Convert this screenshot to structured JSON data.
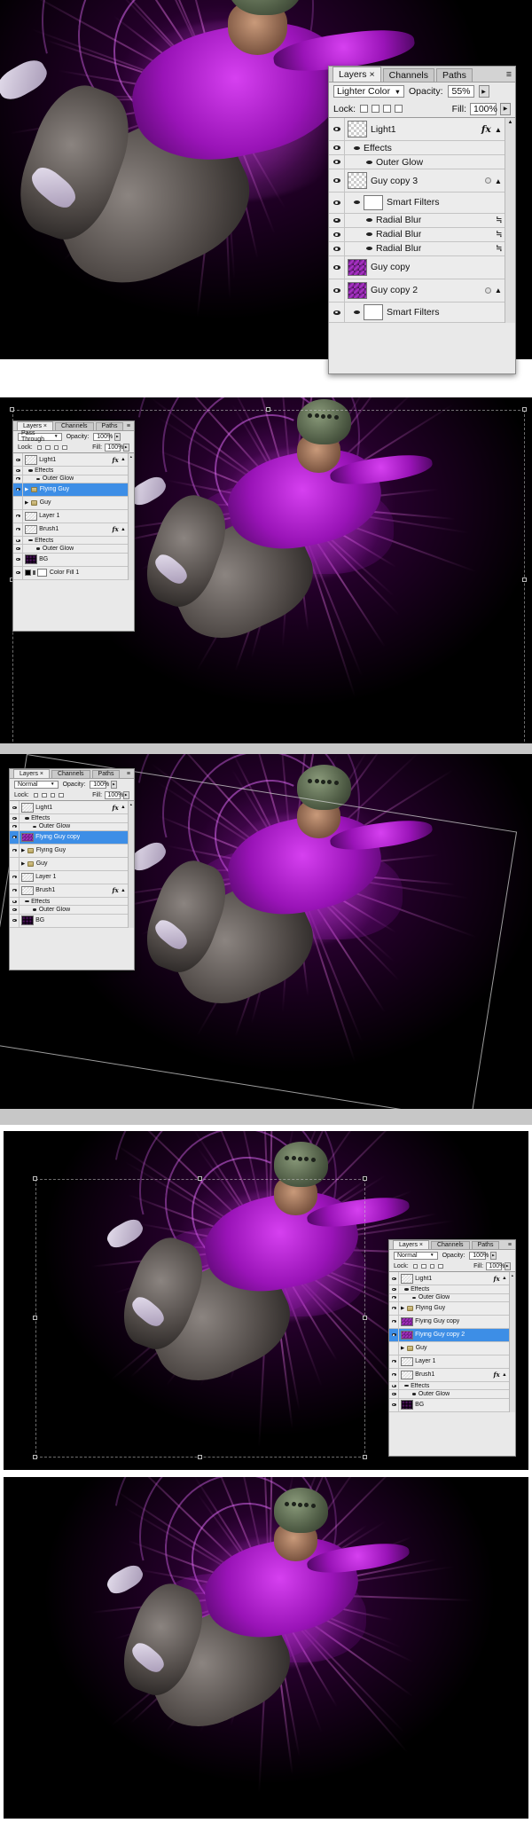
{
  "colors": {
    "panel_bg": "#e9e9e9",
    "selected_row": "#3d8ee6",
    "glow_magenta": "#d640f0",
    "separator_gray": "#c7c7c7"
  },
  "panel1": {
    "tabs": [
      "Layers",
      "Channels",
      "Paths"
    ],
    "tab_close": "×",
    "blend_mode": "Lighter Color",
    "opacity_label": "Opacity:",
    "opacity_value": "55%",
    "lock_label": "Lock:",
    "fill_label": "Fill:",
    "fill_value": "100%",
    "layers": [
      {
        "name": "Light1",
        "kind": "layer",
        "thumb": "checker",
        "badge": "fx"
      },
      {
        "name": "Effects",
        "kind": "effects"
      },
      {
        "name": "Outer Glow",
        "kind": "effect-item"
      },
      {
        "name": "Guy copy 3",
        "kind": "layer",
        "thumb": "checker",
        "badge": "smart"
      },
      {
        "name": "Smart Filters",
        "kind": "smart-filters"
      },
      {
        "name": "Radial Blur",
        "kind": "filter"
      },
      {
        "name": "Radial Blur",
        "kind": "filter"
      },
      {
        "name": "Radial Blur",
        "kind": "filter"
      },
      {
        "name": "Guy copy",
        "kind": "layer",
        "thumb": "photo"
      },
      {
        "name": "Guy copy 2",
        "kind": "layer",
        "thumb": "photo",
        "badge": "smart"
      },
      {
        "name": "Smart Filters",
        "kind": "smart-filters"
      }
    ]
  },
  "panel2": {
    "tabs": [
      "Layers",
      "Channels",
      "Paths"
    ],
    "tab_close": "×",
    "blend_mode": "Pass Through",
    "opacity_label": "Opacity:",
    "opacity_value": "100%",
    "lock_label": "Lock:",
    "fill_label": "Fill:",
    "fill_value": "100%",
    "layers": [
      {
        "name": "Light1",
        "kind": "layer",
        "thumb": "checker",
        "badge": "fx"
      },
      {
        "name": "Effects",
        "kind": "effects"
      },
      {
        "name": "Outer Glow",
        "kind": "effect-item"
      },
      {
        "name": "Flying Guy",
        "kind": "group",
        "selected": true
      },
      {
        "name": "Guy",
        "kind": "group",
        "hidden": true
      },
      {
        "name": "Layer 1",
        "kind": "layer",
        "thumb": "checker"
      },
      {
        "name": "Brush1",
        "kind": "layer",
        "thumb": "checker",
        "badge": "fx"
      },
      {
        "name": "Effects",
        "kind": "effects"
      },
      {
        "name": "Outer Glow",
        "kind": "effect-item"
      },
      {
        "name": "BG",
        "kind": "layer",
        "thumb": "dark"
      },
      {
        "name": "Color Fill 1",
        "kind": "fill",
        "thumb": "black"
      }
    ]
  },
  "panel3": {
    "tabs": [
      "Layers",
      "Channels",
      "Paths"
    ],
    "tab_close": "×",
    "blend_mode": "Normal",
    "opacity_label": "Opacity:",
    "opacity_value": "100%",
    "lock_label": "Lock:",
    "fill_label": "Fill:",
    "fill_value": "100%",
    "layers": [
      {
        "name": "Light1",
        "kind": "layer",
        "thumb": "checker",
        "badge": "fx"
      },
      {
        "name": "Effects",
        "kind": "effects"
      },
      {
        "name": "Outer Glow",
        "kind": "effect-item"
      },
      {
        "name": "Flying Guy copy",
        "kind": "layer",
        "thumb": "photo",
        "selected": true
      },
      {
        "name": "Flying Guy",
        "kind": "group"
      },
      {
        "name": "Guy",
        "kind": "group",
        "hidden": true
      },
      {
        "name": "Layer 1",
        "kind": "layer",
        "thumb": "checker"
      },
      {
        "name": "Brush1",
        "kind": "layer",
        "thumb": "checker",
        "badge": "fx"
      },
      {
        "name": "Effects",
        "kind": "effects"
      },
      {
        "name": "Outer Glow",
        "kind": "effect-item"
      },
      {
        "name": "BG",
        "kind": "layer",
        "thumb": "dark"
      }
    ]
  },
  "panel4": {
    "tabs": [
      "Layers",
      "Channels",
      "Paths"
    ],
    "tab_close": "×",
    "blend_mode": "Normal",
    "opacity_label": "Opacity:",
    "opacity_value": "100%",
    "lock_label": "Lock:",
    "fill_label": "Fill:",
    "fill_value": "100%",
    "layers": [
      {
        "name": "Light1",
        "kind": "layer",
        "thumb": "checker",
        "badge": "fx"
      },
      {
        "name": "Effects",
        "kind": "effects"
      },
      {
        "name": "Outer Glow",
        "kind": "effect-item"
      },
      {
        "name": "Flying Guy",
        "kind": "group"
      },
      {
        "name": "Flying Guy copy",
        "kind": "layer",
        "thumb": "photo"
      },
      {
        "name": "Flying Guy copy 2",
        "kind": "layer",
        "thumb": "photo",
        "selected": true
      },
      {
        "name": "Guy",
        "kind": "group",
        "hidden": true
      },
      {
        "name": "Layer 1",
        "kind": "layer",
        "thumb": "checker"
      },
      {
        "name": "Brush1",
        "kind": "layer",
        "thumb": "checker",
        "badge": "fx"
      },
      {
        "name": "Effects",
        "kind": "effects"
      },
      {
        "name": "Outer Glow",
        "kind": "effect-item"
      },
      {
        "name": "BG",
        "kind": "layer",
        "thumb": "dark"
      }
    ]
  }
}
